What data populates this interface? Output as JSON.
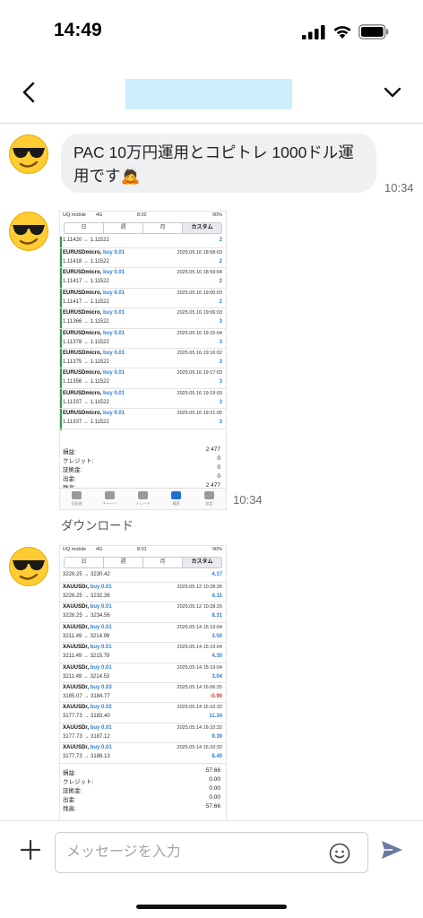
{
  "status_bar": {
    "time": "14:49"
  },
  "messages": {
    "text_message": {
      "text": "PAC 10万円運用とコピトレ 1000ドル運用です🙇",
      "time": "10:34"
    },
    "image1_time": "10:34",
    "download_label": "ダウンロード"
  },
  "shot1": {
    "status": {
      "carrier": "UQ mobile",
      "network": "4G",
      "time": "8:02",
      "battery": "90%"
    },
    "periods": [
      "日",
      "週",
      "月",
      "カスタム"
    ],
    "first_row": {
      "price": "1.11420 → 1.11522",
      "profit": "2"
    },
    "trades": [
      {
        "symbol": "EURUSDmicro,",
        "side": "buy 0.01",
        "datetime": "2025.05.16 18:58:03",
        "price": "1.11418 → 1.11522",
        "profit": "2"
      },
      {
        "symbol": "EURUSDmicro,",
        "side": "buy 0.01",
        "datetime": "2025.05.16 18:59:04",
        "price": "1.11417 → 1.11522",
        "profit": "2"
      },
      {
        "symbol": "EURUSDmicro,",
        "side": "buy 0.01",
        "datetime": "2025.05.16 19:00:03",
        "price": "1.11417 → 1.11522",
        "profit": "2"
      },
      {
        "symbol": "EURUSDmicro,",
        "side": "buy 0.01",
        "datetime": "2025.05.16 19:06:03",
        "price": "1.11366 → 1.11522",
        "profit": "3"
      },
      {
        "symbol": "EURUSDmicro,",
        "side": "buy 0.01",
        "datetime": "2025.05.16 19:15:04",
        "price": "1.11378 → 1.11522",
        "profit": "3"
      },
      {
        "symbol": "EURUSDmicro,",
        "side": "buy 0.01",
        "datetime": "2025.05.16 19:16:02",
        "price": "1.11375 → 1.11522",
        "profit": "3"
      },
      {
        "symbol": "EURUSDmicro,",
        "side": "buy 0.01",
        "datetime": "2025.05.16 19:17:03",
        "price": "1.11356 → 1.11522",
        "profit": "3"
      },
      {
        "symbol": "EURUSDmicro,",
        "side": "buy 0.01",
        "datetime": "2025.05.16 19:19:03",
        "price": "1.11337 → 1.11522",
        "profit": "3"
      },
      {
        "symbol": "EURUSDmicro,",
        "side": "buy 0.01",
        "datetime": "2025.05.16 19:21:05",
        "price": "1.11337 → 1.11522",
        "profit": "3"
      }
    ],
    "summary": [
      {
        "label": "損益:",
        "value": "2 477"
      },
      {
        "label": "クレジット:",
        "value": "0"
      },
      {
        "label": "証拠金:",
        "value": "0"
      },
      {
        "label": "出金:",
        "value": "0"
      },
      {
        "label": "残高:",
        "value": "2 477"
      }
    ],
    "tabs": [
      "気配値",
      "チャート",
      "トレード",
      "履歴",
      "設定"
    ]
  },
  "shot2": {
    "status": {
      "carrier": "UQ mobile",
      "network": "4G",
      "time": "8:01",
      "battery": "90%"
    },
    "periods": [
      "日",
      "週",
      "月",
      "カスタム"
    ],
    "first_row": {
      "price": "3226.25 → 3230.42",
      "profit": "4.17"
    },
    "trades": [
      {
        "symbol": "XAUUSDr,",
        "side": "buy 0.01",
        "datetime": "2025.05.12 10:28:26",
        "price": "3226.25 → 3232.36",
        "profit": "6.11"
      },
      {
        "symbol": "XAUUSDr,",
        "side": "buy 0.01",
        "datetime": "2025.05.12 10:28:26",
        "price": "3226.25 → 3234.56",
        "profit": "8.31"
      },
      {
        "symbol": "XAUUSDr,",
        "side": "buy 0.01",
        "datetime": "2025.05.14 15:19:04",
        "price": "3211.49 → 3214.99",
        "profit": "3.50"
      },
      {
        "symbol": "XAUUSDr,",
        "side": "buy 0.01",
        "datetime": "2025.05.14 15:19:04",
        "price": "3211.49 → 3215.79",
        "profit": "4.30"
      },
      {
        "symbol": "XAUUSDr,",
        "side": "buy 0.01",
        "datetime": "2025.05.14 15:19:04",
        "price": "3211.49 → 3214.53",
        "profit": "3.04"
      },
      {
        "symbol": "XAUUSDr,",
        "side": "buy 0.03",
        "datetime": "2025.05.14 16:06:25",
        "price": "3185.07 → 3184.77",
        "profit": "-0.90",
        "negative": true
      },
      {
        "symbol": "XAUUSDr,",
        "side": "buy 0.02",
        "datetime": "2025.05.14 16:10:32",
        "price": "3177.73 → 3183.40",
        "profit": "11.34"
      },
      {
        "symbol": "XAUUSDr,",
        "side": "buy 0.01",
        "datetime": "2025.05.14 16:10:32",
        "price": "3177.73 → 3187.12",
        "profit": "9.39"
      },
      {
        "symbol": "XAUUSDr,",
        "side": "buy 0.01",
        "datetime": "2025.05.14 16:10:32",
        "price": "3177.73 → 3186.13",
        "profit": "8.40"
      }
    ],
    "summary": [
      {
        "label": "損益:",
        "value": "57.66"
      },
      {
        "label": "クレジット:",
        "value": "0.00"
      },
      {
        "label": "証拠金:",
        "value": "0.00"
      },
      {
        "label": "出金:",
        "value": "0.00"
      },
      {
        "label": "残高:",
        "value": "57.66"
      }
    ]
  },
  "composer": {
    "placeholder": "メッセージを入力"
  },
  "colors": {
    "profit_blue": "#2d7fd0",
    "loss_red": "#d9363e",
    "bubble_bg": "#eef0f2",
    "header_redact": "#cdeefb"
  },
  "icons": [
    "back-chevron-icon",
    "chevron-down-icon",
    "plus-icon",
    "emoji-icon",
    "send-icon",
    "sunglasses-emoji-icon"
  ]
}
